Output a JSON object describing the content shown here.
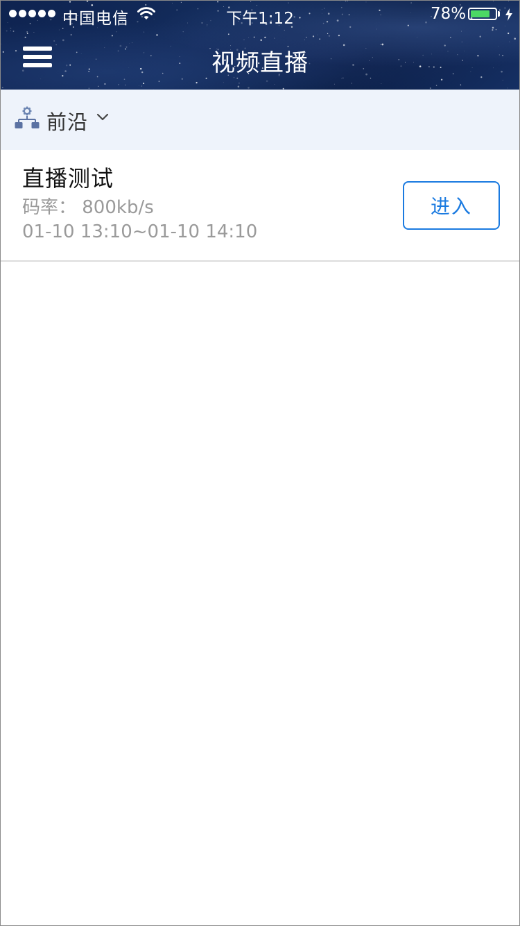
{
  "status_bar": {
    "carrier": "中国电信",
    "time": "下午1:12",
    "battery_percent": "78%",
    "battery_level": 0.78,
    "battery_color": "#4cd964",
    "signal_bars": 5,
    "icons": [
      "wifi-icon",
      "charging-icon"
    ]
  },
  "nav": {
    "title": "视频直播",
    "menu_icon": "hamburger-menu-icon"
  },
  "filter": {
    "label": "前沿",
    "icon": "organization-icon",
    "dropdown_icon": "chevron-down-icon"
  },
  "list": {
    "items": [
      {
        "title": "直播测试",
        "bitrate": "码率： 800kb/s",
        "time_range": "01-10 13:10~01-10 14:10",
        "action_label": "进入"
      }
    ]
  },
  "colors": {
    "accent": "#1a7ae0",
    "filter_bg": "#eef3fb",
    "secondary_text": "#9a9a9a"
  }
}
